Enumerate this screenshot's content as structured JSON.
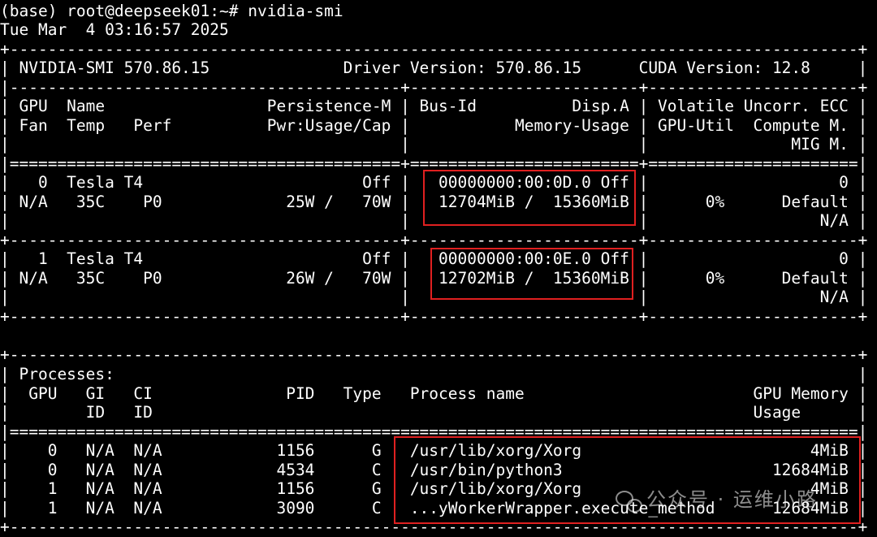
{
  "terminal": {
    "lines": [
      "(base) root@deepseek01:~# nvidia-smi",
      "Tue Mar  4 03:16:57 2025",
      "+-----------------------------------------------------------------------------------------+",
      "| NVIDIA-SMI 570.86.15              Driver Version: 570.86.15      CUDA Version: 12.8     |",
      "|-----------------------------------------+------------------------+----------------------+",
      "| GPU  Name                 Persistence-M | Bus-Id          Disp.A | Volatile Uncorr. ECC |",
      "| Fan  Temp   Perf          Pwr:Usage/Cap |           Memory-Usage | GPU-Util  Compute M. |",
      "|                                         |                        |               MIG M. |",
      "|=========================================+========================+======================|",
      "|   0  Tesla T4                       Off |   00000000:00:0D.0 Off |                    0 |",
      "| N/A   35C    P0             25W /   70W |   12704MiB /  15360MiB |      0%      Default |",
      "|                                         |                        |                  N/A |",
      "+-----------------------------------------+------------------------+----------------------+",
      "|   1  Tesla T4                       Off |   00000000:00:0E.0 Off |                    0 |",
      "| N/A   35C    P0             26W /   70W |   12702MiB /  15360MiB |      0%      Default |",
      "|                                         |                        |                  N/A |",
      "+-----------------------------------------+------------------------+----------------------+",
      "",
      "+-----------------------------------------------------------------------------------------+",
      "| Processes:                                                                              |",
      "|  GPU   GI   CI              PID   Type   Process name                        GPU Memory |",
      "|        ID   ID                                                               Usage      |",
      "|=========================================================================================|",
      "|    0   N/A  N/A            1156      G   /usr/lib/xorg/Xorg                        4MiB |",
      "|    0   N/A  N/A            4534      C   /usr/bin/python3                      12684MiB |",
      "|    1   N/A  N/A            1156      G   /usr/lib/xorg/Xorg                        4MiB |",
      "|    1   N/A  N/A            3090      C   ...yWorkerWrapper.execute_method      12684MiB |",
      "+-----------------------------------------------------------------------------------------+"
    ]
  },
  "watermark": {
    "text": "公众号 · 运维小路"
  },
  "colors": {
    "background": "#000000",
    "foreground": "#ffffff",
    "highlight": "#e02020"
  }
}
